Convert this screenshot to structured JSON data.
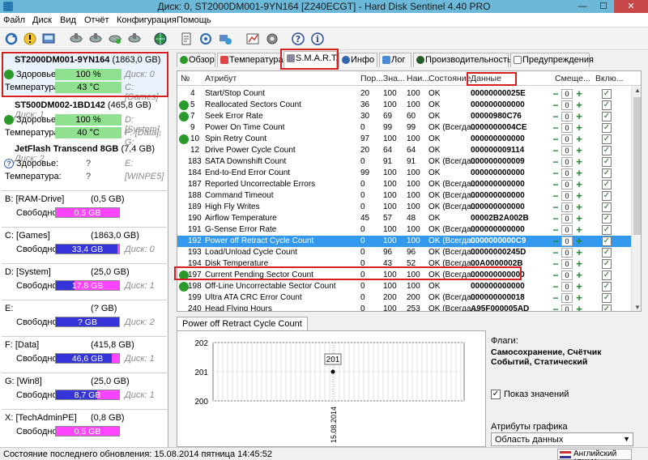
{
  "window": {
    "title": "Диск: 0, ST2000DM001-9YN164 [Z240ECGT]  -  Hard Disk Sentinel 4.40 PRO",
    "min": "—",
    "max": "☐",
    "close": "✕"
  },
  "menu": [
    "Файл",
    "Диск",
    "Вид",
    "Отчёт",
    "Конфигурация",
    "Помощь"
  ],
  "disks": [
    {
      "name": "ST2000DM001-9YN164",
      "size": "(1863,0 GB)",
      "health_label": "Здоровье:",
      "health": "100 %",
      "health_aux": "Диск: 0",
      "temp_label": "Температура:",
      "temp": "43 °C",
      "temp_aux": "C: [Games]",
      "selected": true
    },
    {
      "name": "ST500DM002-1BD142",
      "size": "(465,8 GB)",
      "disk_no": "Диск: 1",
      "health_label": "Здоровье:",
      "health": "100 %",
      "health_aux": "D: [System],",
      "temp_label": "Температура:",
      "temp": "40 °C",
      "temp_aux": "F: [Data], G:"
    },
    {
      "name": "JetFlash Transcend 8GB",
      "size": "(7,4 GB)",
      "disk_no": "Диск: 2",
      "health_label": "Здоровье:",
      "health": "?",
      "health_aux": "E:",
      "temp_label": "Температура:",
      "temp": "?",
      "temp_aux": "[WINPE5]"
    }
  ],
  "partitions": [
    {
      "name": "B: [RAM-Drive]",
      "size": "(0,5 GB)",
      "free_label": "Свободно",
      "free": "0,5 GB",
      "aux": "",
      "fill": 0.0
    },
    {
      "name": "C: [Games]",
      "size": "(1863,0 GB)",
      "free_label": "Свободно",
      "free": "33,4 GB",
      "aux": "Диск: 0",
      "fill": 0.98
    },
    {
      "name": "D: [System]",
      "size": "(25,0 GB)",
      "free_label": "Свободно",
      "free": "17,8 GB",
      "aux": "Диск: 1",
      "fill": 0.29
    },
    {
      "name": "E:",
      "size": "(? GB)",
      "free_label": "Свободно",
      "free": "? GB",
      "aux": "Диск: 2",
      "fill": 1.0
    },
    {
      "name": "F: [Data]",
      "size": "(415,8 GB)",
      "free_label": "Свободно",
      "free": "46,6 GB",
      "aux": "Диск: 1",
      "fill": 0.89
    },
    {
      "name": "G: [Win8]",
      "size": "(25,0 GB)",
      "free_label": "Свободно",
      "free": "8,7 GB",
      "aux": "Диск: 1",
      "fill": 0.65
    },
    {
      "name": "X: [TechAdminPE]",
      "size": "(0,8 GB)",
      "free_label": "Свободно",
      "free": "0,5 GB",
      "aux": "",
      "fill": 0.0
    }
  ],
  "tabs": [
    "Обзор",
    "Температура",
    "S.M.A.R.T.",
    "Инфо",
    "Лог",
    "Производительность",
    "Предупреждения"
  ],
  "table": {
    "headers": [
      "№",
      "Атрибут",
      "Пор...",
      "Зна...",
      "Наи...",
      "Состояние",
      "Данные",
      "Смеще...",
      "Вклю..."
    ],
    "rows": [
      {
        "no": "4",
        "attr": "Start/Stop Count",
        "thr": "20",
        "val": "100",
        "worst": "100",
        "state": "OK",
        "data": "00000000025E",
        "ok": false
      },
      {
        "no": "5",
        "attr": "Reallocated Sectors Count",
        "thr": "36",
        "val": "100",
        "worst": "100",
        "state": "OK",
        "data": "000000000000",
        "ok": true
      },
      {
        "no": "7",
        "attr": "Seek Error Rate",
        "thr": "30",
        "val": "69",
        "worst": "60",
        "state": "OK",
        "data": "00000980C76",
        "ok": true
      },
      {
        "no": "9",
        "attr": "Power On Time Count",
        "thr": "0",
        "val": "99",
        "worst": "99",
        "state": "OK (Всегда...",
        "data": "0000000004CE",
        "ok": false
      },
      {
        "no": "10",
        "attr": "Spin Retry Count",
        "thr": "97",
        "val": "100",
        "worst": "100",
        "state": "OK",
        "data": "000000000000",
        "ok": true
      },
      {
        "no": "12",
        "attr": "Drive Power Cycle Count",
        "thr": "20",
        "val": "64",
        "worst": "64",
        "state": "OK",
        "data": "000000009114",
        "ok": false
      },
      {
        "no": "183",
        "attr": "SATA Downshift Count",
        "thr": "0",
        "val": "91",
        "worst": "91",
        "state": "OK (Всегда...",
        "data": "000000000009",
        "ok": false
      },
      {
        "no": "184",
        "attr": "End-to-End Error Count",
        "thr": "99",
        "val": "100",
        "worst": "100",
        "state": "OK",
        "data": "000000000000",
        "ok": false
      },
      {
        "no": "187",
        "attr": "Reported Uncorrectable Errors",
        "thr": "0",
        "val": "100",
        "worst": "100",
        "state": "OK (Всегда...",
        "data": "000000000000",
        "ok": false
      },
      {
        "no": "188",
        "attr": "Command Timeout",
        "thr": "0",
        "val": "100",
        "worst": "100",
        "state": "OK (Всегда...",
        "data": "000000000000",
        "ok": false
      },
      {
        "no": "189",
        "attr": "High Fly Writes",
        "thr": "0",
        "val": "100",
        "worst": "100",
        "state": "OK (Всегда...",
        "data": "000000000000",
        "ok": false
      },
      {
        "no": "190",
        "attr": "Airflow Temperature",
        "thr": "45",
        "val": "57",
        "worst": "48",
        "state": "OK",
        "data": "00002B2A002B",
        "ok": false
      },
      {
        "no": "191",
        "attr": "G-Sense Error Rate",
        "thr": "0",
        "val": "100",
        "worst": "100",
        "state": "OK (Всегда...",
        "data": "000000000000",
        "ok": false
      },
      {
        "no": "192",
        "attr": "Power off Retract Cycle Count",
        "thr": "0",
        "val": "100",
        "worst": "100",
        "state": "OK (Всегда...",
        "data": "0000000000C9",
        "ok": false,
        "selected": true
      },
      {
        "no": "193",
        "attr": "Load/Unload Cycle Count",
        "thr": "0",
        "val": "96",
        "worst": "96",
        "state": "OK (Всегда...",
        "data": "00000000245D",
        "ok": false
      },
      {
        "no": "194",
        "attr": "Disk Temperature",
        "thr": "0",
        "val": "43",
        "worst": "52",
        "state": "OK (Всегда...",
        "data": "00A0000002B",
        "ok": false
      },
      {
        "no": "197",
        "attr": "Current Pending Sector Count",
        "thr": "0",
        "val": "100",
        "worst": "100",
        "state": "OK (Всегда...",
        "data": "000000000000",
        "ok": true
      },
      {
        "no": "198",
        "attr": "Off-Line Uncorrectable Sector Count",
        "thr": "0",
        "val": "100",
        "worst": "100",
        "state": "OK",
        "data": "000000000000",
        "ok": true
      },
      {
        "no": "199",
        "attr": "Ultra ATA CRC Error Count",
        "thr": "0",
        "val": "200",
        "worst": "200",
        "state": "OK (Всегда...",
        "data": "000000000018",
        "ok": false
      },
      {
        "no": "240",
        "attr": "Head Flying Hours",
        "thr": "0",
        "val": "100",
        "worst": "253",
        "state": "OK (Всегда...",
        "data": "A95F000005AD",
        "ok": false
      }
    ],
    "offset_value": "0"
  },
  "lower": {
    "tab": "Power off Retract Cycle Count",
    "chart_data": {
      "type": "line",
      "x": [
        "15.08.2014"
      ],
      "values": [
        201
      ],
      "ylim": [
        200,
        202
      ],
      "yticks": [
        "202",
        "201",
        "200"
      ],
      "point_label": "201"
    },
    "flags_title": "Флаги:",
    "flags": "Самосохранение, Счётчик Событий, Статический",
    "show_values": "Показ значений",
    "graph_attr_title": "Атрибуты графика",
    "graph_attr_value": "Область данных"
  },
  "status": {
    "text": "Состояние последнего обновления: 15.08.2014 пятница 14:45:52",
    "lang": "Английский (США)"
  },
  "colors": {
    "ok": "#2a9a2a",
    "selected": "#3399ee",
    "highlight": "#d42020",
    "part_free": "#ff44ff",
    "part_used": "#3434d8"
  }
}
